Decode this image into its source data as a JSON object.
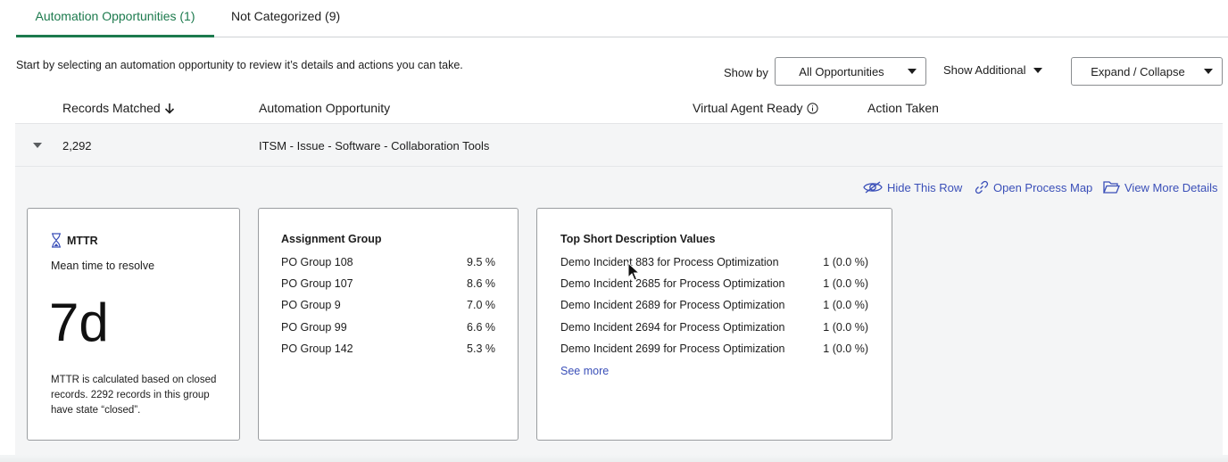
{
  "tabs": [
    {
      "label": "Automation Opportunities (1)",
      "active": true
    },
    {
      "label": "Not Categorized (9)",
      "active": false
    }
  ],
  "intro_text": "Start by selecting an automation opportunity to review it’s details and actions you can take.",
  "controls": {
    "show_by_label": "Show by",
    "show_by_value": "All Opportunities",
    "show_additional_label": "Show Additional",
    "expand_collapse_label": "Expand / Collapse"
  },
  "table": {
    "columns": [
      "Records Matched",
      "Automation Opportunity",
      "Virtual Agent Ready",
      "Action Taken"
    ],
    "sort_icon": "arrow-down-icon",
    "info_icon": "info-circle-icon"
  },
  "group": {
    "records_matched": "2,292",
    "automation_opportunity": "ITSM - Issue - Software - Collaboration Tools"
  },
  "actions": {
    "hide_row": "Hide This Row",
    "open_process_map": "Open Process Map",
    "view_more_details": "View More Details"
  },
  "mttr_card": {
    "title": "MTTR",
    "subtitle": "Mean time to resolve",
    "value": "7d",
    "note": "MTTR is calculated based on closed records. 2292 records in this group have state “closed”."
  },
  "assignment_card": {
    "title": "Assignment Group",
    "rows": [
      {
        "name": "PO Group 108",
        "value": "9.5 %"
      },
      {
        "name": "PO Group 107",
        "value": "8.6 %"
      },
      {
        "name": "PO Group 9",
        "value": "7.0 %"
      },
      {
        "name": "PO Group 99",
        "value": "6.6 %"
      },
      {
        "name": "PO Group 142",
        "value": "5.3 %"
      }
    ]
  },
  "description_card": {
    "title": "Top Short Description Values",
    "rows": [
      {
        "name": "Demo Incident 883 for Process Optimization",
        "value": "1 (0.0 %)"
      },
      {
        "name": "Demo Incident 2685 for Process Optimization",
        "value": "1 (0.0 %)"
      },
      {
        "name": "Demo Incident 2689 for Process Optimization",
        "value": "1 (0.0 %)"
      },
      {
        "name": "Demo Incident 2694 for Process Optimization",
        "value": "1 (0.0 %)"
      },
      {
        "name": "Demo Incident 2699 for Process Optimization",
        "value": "1 (0.0 %)"
      }
    ],
    "see_more": "See more"
  },
  "colors": {
    "accent_green": "#1c7a4d",
    "link_blue": "#3a4fb8"
  }
}
